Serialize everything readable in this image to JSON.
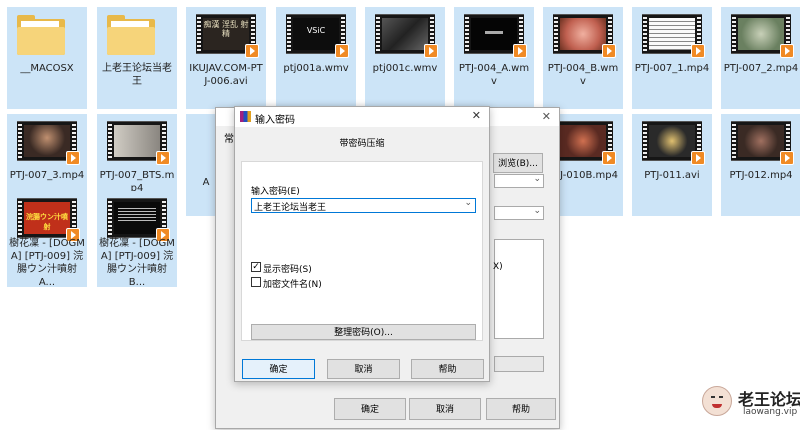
{
  "files": [
    {
      "label": "__MACOSX",
      "kind": "folder"
    },
    {
      "label": "上老王论坛当老王",
      "kind": "folder"
    },
    {
      "label": "IKUJAV.COM-PTJ-006.avi",
      "kind": "video",
      "screen": "#2b2520",
      "text": "痴漢\n淫乱\n射精"
    },
    {
      "label": "ptj001a.wmv",
      "kind": "video",
      "screen": "#0d0d0d",
      "text": "VSiC"
    },
    {
      "label": "ptj001c.wmv",
      "kind": "video",
      "screen": "#3a3a3a",
      "text": ""
    },
    {
      "label": "PTJ-004_A.wmv",
      "kind": "video",
      "screen": "#050505",
      "text": ""
    },
    {
      "label": "PTJ-004_B.wmv",
      "kind": "video",
      "screen": "#d48a7a",
      "text": ""
    },
    {
      "label": "PTJ-007_1.mp4",
      "kind": "video",
      "screen": "#f4f4f4",
      "text": ""
    },
    {
      "label": "PTJ-007_2.mp4",
      "kind": "video",
      "screen": "#8aa07a",
      "text": ""
    },
    {
      "label": "PTJ-007_3.mp4",
      "kind": "video",
      "screen": "#3a2a24",
      "text": ""
    },
    {
      "label": "PTJ-007_BTS.mp4",
      "kind": "video",
      "screen": "#b8b4ac",
      "text": ""
    },
    {
      "label": "PTJ-010B.mp4",
      "kind": "video",
      "screen": "#5a2a22",
      "text": ""
    },
    {
      "label": "PTJ-011.avi",
      "kind": "video",
      "screen": "#2a2a2a",
      "text": ""
    },
    {
      "label": "PTJ-012.mp4",
      "kind": "video",
      "screen": "#4a3a34",
      "text": ""
    },
    {
      "label": "樹花凜 - [DOGMA] [PTJ-009] 浣腸ウン汁噴射 A...",
      "kind": "video",
      "screen": "#c0301a",
      "text": "浣腸ウン汁噴射"
    },
    {
      "label": "樹花凜 - [DOGMA] [PTJ-009] 浣腸ウン汁噴射 B...",
      "kind": "video",
      "screen": "#0a0a0a",
      "text": ""
    }
  ],
  "partial_labels": {
    "row2_col3": "A"
  },
  "back_dialog": {
    "title_fragment": "常",
    "browse_label": "浏览(B)...",
    "fragment_x": "X)",
    "ok": "确定",
    "cancel": "取消",
    "help": "帮助"
  },
  "password_dialog": {
    "title": "输入密码",
    "close_icon": "close-icon",
    "tab": "带密码压缩",
    "prompt": "输入密码(E)",
    "password_value": "上老王论坛当老王",
    "show_password": "显示密码(S)",
    "show_password_checked": true,
    "encrypt_filenames": "加密文件名(N)",
    "encrypt_filenames_checked": false,
    "organize": "整理密码(O)...",
    "ok": "确定",
    "cancel": "取消",
    "help": "帮助"
  },
  "watermark": {
    "title": "老王论坛",
    "url": "laowang.vip"
  }
}
